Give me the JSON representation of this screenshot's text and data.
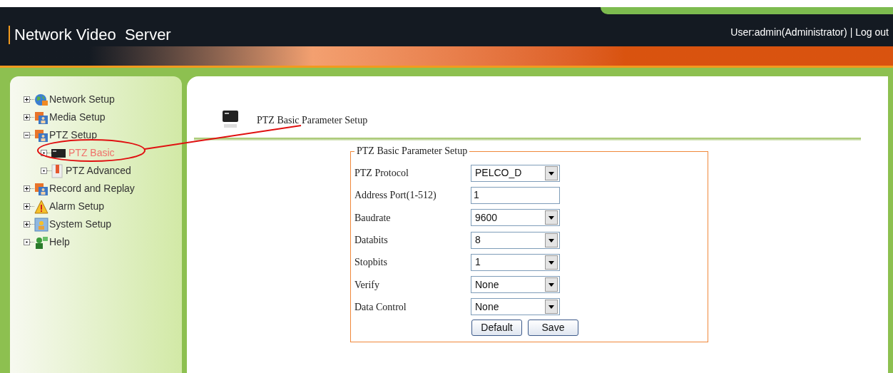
{
  "header": {
    "title": "Network Video  Server",
    "user": "User:admin(Administrator)",
    "separator": "|",
    "logout": "Log out"
  },
  "sidebar": {
    "items": [
      {
        "label": "Network Setup",
        "expanded": false
      },
      {
        "label": "Media Setup",
        "expanded": false
      },
      {
        "label": "PTZ Setup",
        "expanded": true,
        "children": [
          {
            "label": "PTZ Basic",
            "selected": true
          },
          {
            "label": "PTZ Advanced",
            "selected": false
          }
        ]
      },
      {
        "label": "Record and Replay",
        "expanded": false
      },
      {
        "label": "Alarm Setup",
        "expanded": false
      },
      {
        "label": "System Setup",
        "expanded": false
      },
      {
        "label": "Help"
      }
    ]
  },
  "page": {
    "title": "PTZ Basic Parameter Setup"
  },
  "form": {
    "legend": "PTZ Basic Parameter Setup",
    "fields": [
      {
        "label": "PTZ Protocol",
        "kind": "select",
        "value": "PELCO_D"
      },
      {
        "label": "Address Port(1-512)",
        "kind": "text",
        "value": "1"
      },
      {
        "label": "Baudrate",
        "kind": "select",
        "value": "9600"
      },
      {
        "label": "Databits",
        "kind": "select",
        "value": "8"
      },
      {
        "label": "Stopbits",
        "kind": "select",
        "value": "1"
      },
      {
        "label": "Verify",
        "kind": "select",
        "value": "None"
      },
      {
        "label": "Data Control",
        "kind": "select",
        "value": "None"
      }
    ],
    "buttons": [
      "Default",
      "Save"
    ]
  }
}
